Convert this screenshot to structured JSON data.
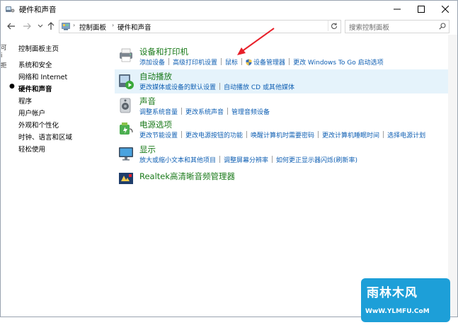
{
  "window": {
    "title": "硬件和声音",
    "minimize_icon": "minimize-icon",
    "maximize_icon": "maximize-icon",
    "close_icon": "close-icon"
  },
  "address_bar": {
    "back_icon": "arrow-left-icon",
    "forward_icon": "arrow-right-icon",
    "recent_icon": "chevron-down-icon",
    "up_icon": "arrow-up-icon",
    "breadcrumbs": [
      "控制面板",
      "硬件和声音"
    ],
    "refresh_icon": "refresh-icon",
    "search_placeholder": "搜索控制面板"
  },
  "sidebar": {
    "items": [
      {
        "label": "控制面板主页",
        "active": false
      },
      {
        "label": "系统和安全",
        "active": false
      },
      {
        "label": "网络和 Internet",
        "active": false
      },
      {
        "label": "硬件和声音",
        "active": true
      },
      {
        "label": "程序",
        "active": false
      },
      {
        "label": "用户帐户",
        "active": false
      },
      {
        "label": "外观和个性化",
        "active": false
      },
      {
        "label": "时钟、语言和区域",
        "active": false
      },
      {
        "label": "轻松使用",
        "active": false
      }
    ],
    "edge_chars": [
      "可",
      "i",
      "拒"
    ]
  },
  "sections": [
    {
      "title": "设备和打印机",
      "icon": "printer-icon",
      "highlighted": false,
      "links": [
        "添加设备",
        "高级打印机设置",
        "鼠标",
        "设备管理器",
        "更改 Windows To Go 启动选项"
      ],
      "shield_link": "设备管理器"
    },
    {
      "title": "自动播放",
      "icon": "autoplay-icon",
      "highlighted": true,
      "links": [
        "更改媒体或设备的默认设置",
        "自动播放 CD 或其他媒体"
      ]
    },
    {
      "title": "声音",
      "icon": "speaker-icon",
      "highlighted": false,
      "links": [
        "调整系统音量",
        "更改系统声音",
        "管理音频设备"
      ]
    },
    {
      "title": "电源选项",
      "icon": "power-options-icon",
      "highlighted": false,
      "links": [
        "更改节能设置",
        "更改电源按钮的功能",
        "唤醒计算机时需要密码",
        "更改计算机睡眠时间",
        "选择电源计划"
      ]
    },
    {
      "title": "显示",
      "icon": "display-icon",
      "highlighted": false,
      "links": [
        "放大或缩小文本和其他项目",
        "调整屏幕分辨率",
        "如何更正显示器闪烁(刷新率)"
      ]
    },
    {
      "title": "Realtek高清晰音频管理器",
      "icon": "realtek-audio-icon",
      "highlighted": false,
      "links": []
    }
  ],
  "annotation": {
    "arrow_color": "#e8202a",
    "points_to": "鼠标"
  },
  "watermark": {
    "main": "雨林木风",
    "sub": "WwW.YLMFU.CoM",
    "color": "#1d9fd8"
  },
  "colors": {
    "link": "#0f5fb3",
    "section_title": "#1a7a1a",
    "highlight": "#e5f3fb"
  }
}
